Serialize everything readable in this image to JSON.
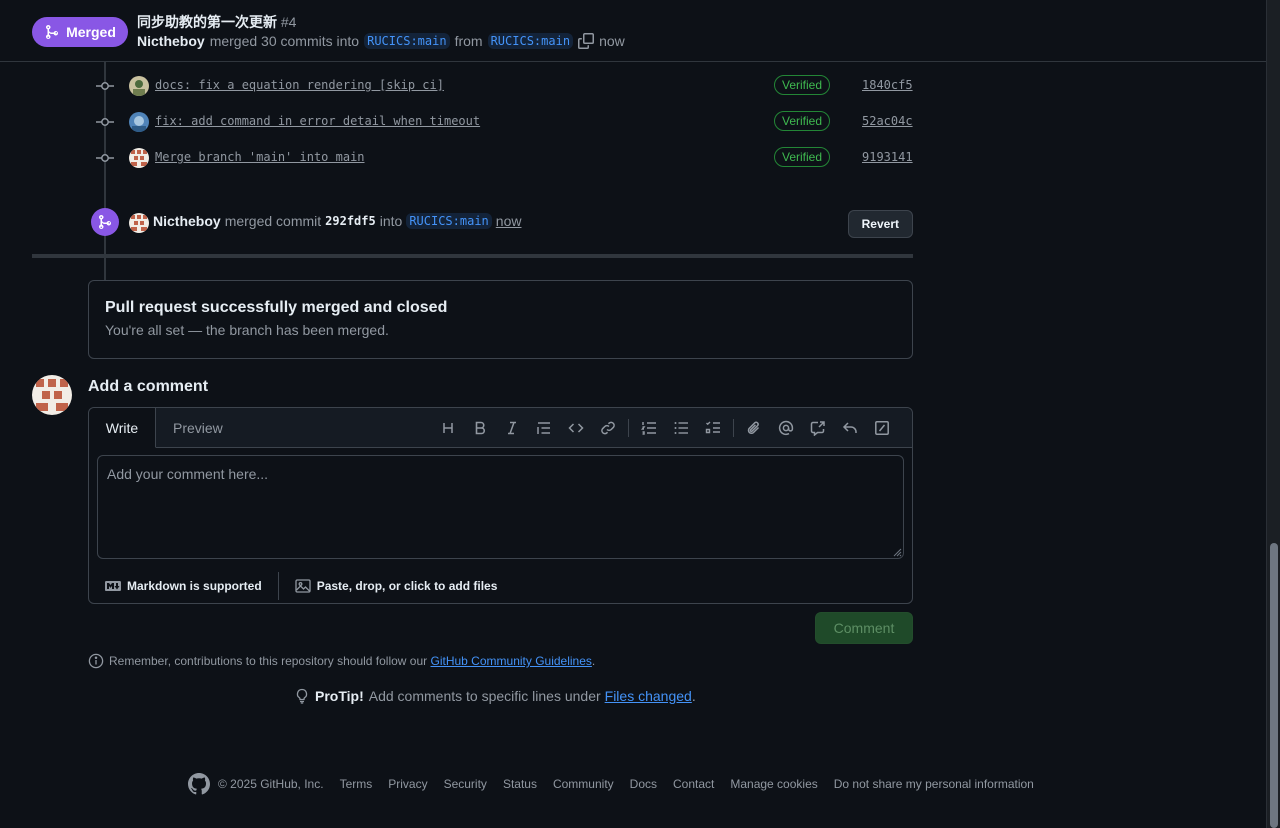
{
  "header": {
    "state_label": "Merged",
    "title": "同步助教的第一次更新",
    "number": "#4",
    "author": "Nictheboy",
    "merged_text": "merged 30 commits into",
    "base_branch": "RUCICS:main",
    "from_text": "from",
    "head_branch": "RUCICS:main",
    "time": "now"
  },
  "commits": [
    {
      "message": "docs: fix a equation rendering [skip ci]",
      "badge": "Verified",
      "sha": "1840cf5"
    },
    {
      "message": "fix: add command in error detail when timeout",
      "badge": "Verified",
      "sha": "52ac04c"
    },
    {
      "message": "Merge branch 'main' into main",
      "badge": "Verified",
      "sha": "9193141"
    }
  ],
  "merge_event": {
    "author": "Nictheboy",
    "text1": "merged commit",
    "sha": "292fdf5",
    "text2": "into",
    "branch": "RUCICS:main",
    "time": "now",
    "revert_label": "Revert"
  },
  "merged_box": {
    "title": "Pull request successfully merged and closed",
    "subtitle": "You're all set — the branch has been merged."
  },
  "comment": {
    "title": "Add a comment",
    "tab_write": "Write",
    "tab_preview": "Preview",
    "placeholder": "Add your comment here...",
    "markdown_note": "Markdown is supported",
    "attach_note": "Paste, drop, or click to add files",
    "submit_label": "Comment"
  },
  "guidelines": {
    "text": "Remember, contributions to this repository should follow our",
    "link": "GitHub Community Guidelines",
    "end": "."
  },
  "protip": {
    "label": "ProTip!",
    "text": "Add comments to specific lines under",
    "link": "Files changed",
    "end": "."
  },
  "footer": {
    "copyright": "© 2025 GitHub, Inc.",
    "links": [
      "Terms",
      "Privacy",
      "Security",
      "Status",
      "Community",
      "Docs",
      "Contact",
      "Manage cookies",
      "Do not share my personal information"
    ]
  },
  "colors": {
    "background": "#0d1117",
    "merged_purple": "#8957e5",
    "link_blue": "#4493f8",
    "verified_green": "#3fb950",
    "border": "#3d444d"
  }
}
